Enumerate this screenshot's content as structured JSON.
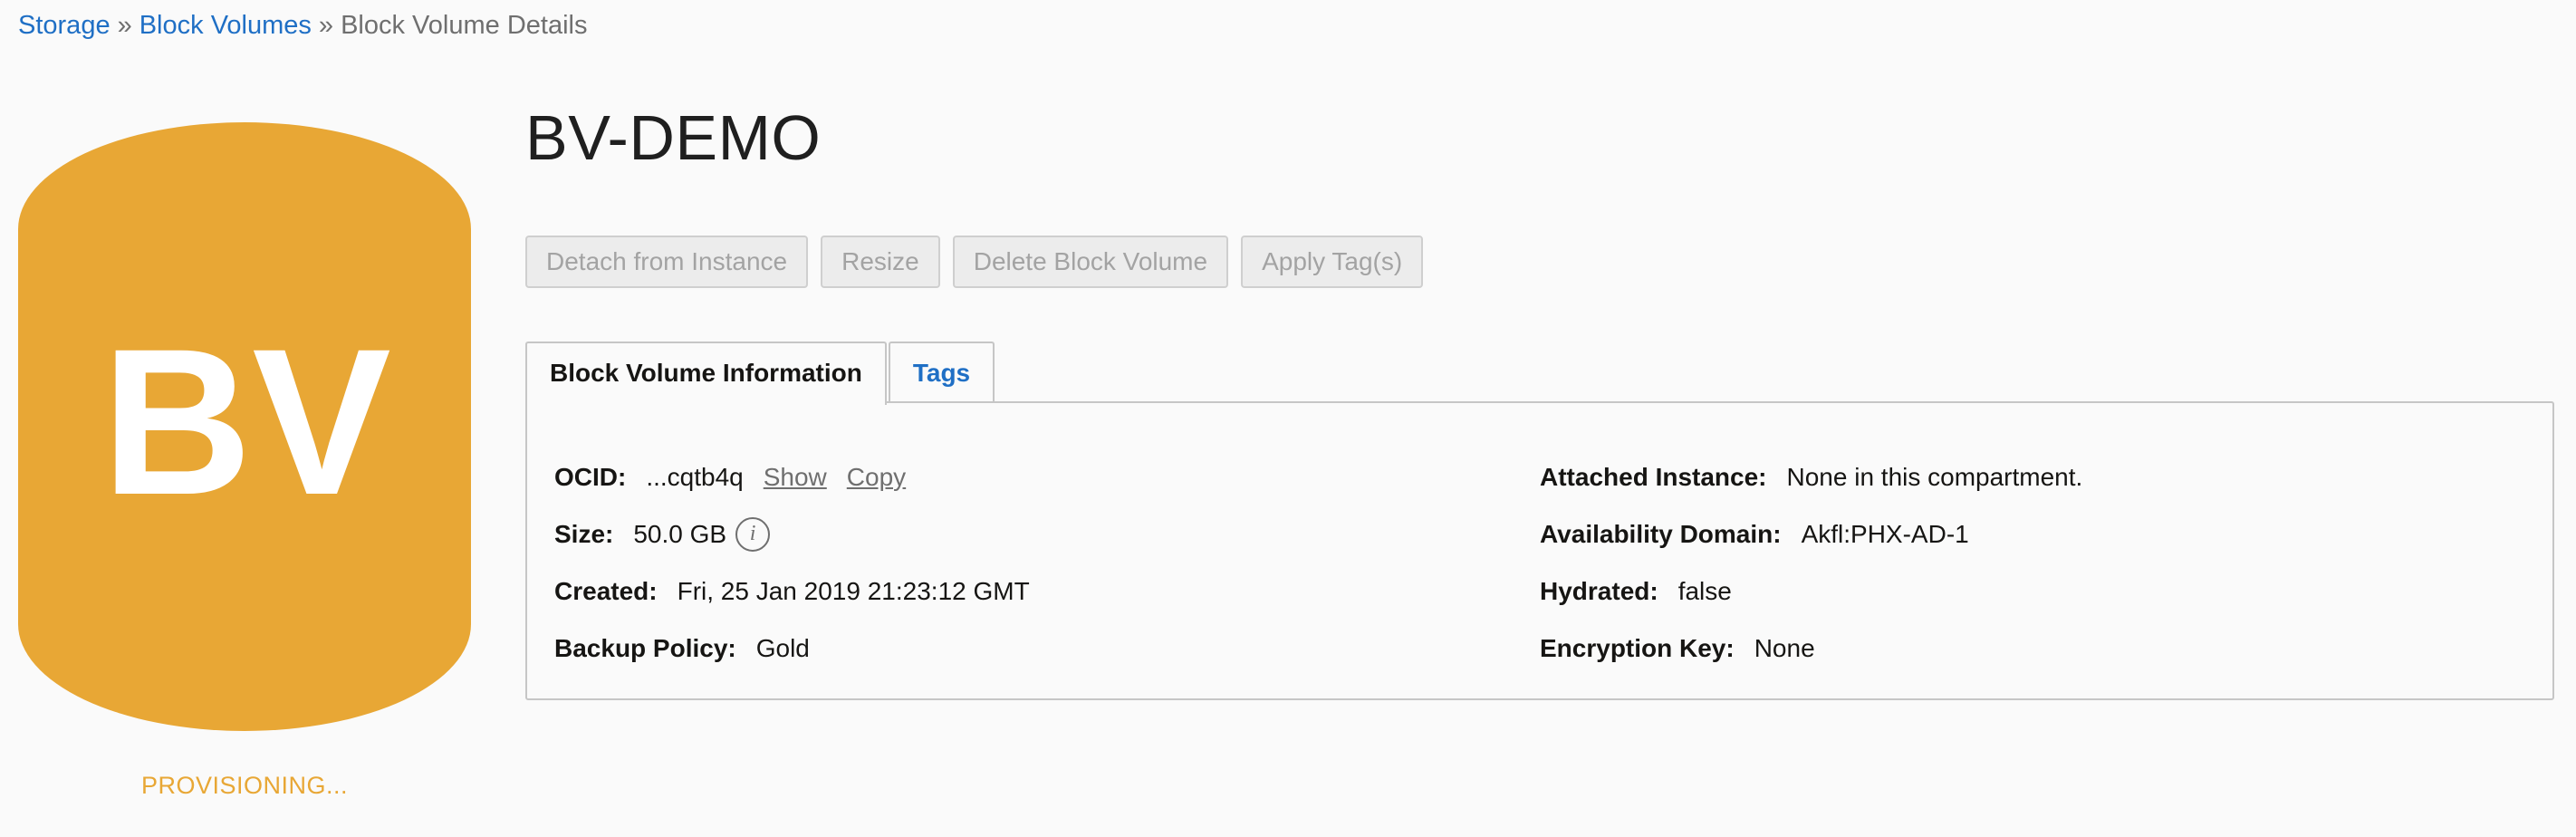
{
  "breadcrumb": {
    "items": [
      "Storage",
      "Block Volumes",
      "Block Volume Details"
    ],
    "separator": "»"
  },
  "resource": {
    "icon_text": "BV",
    "icon_color": "#e8a735",
    "status": "PROVISIONING..."
  },
  "title": "BV-DEMO",
  "actions": {
    "detach": "Detach from Instance",
    "resize": "Resize",
    "delete": "Delete Block Volume",
    "apply_tags": "Apply Tag(s)"
  },
  "tabs": [
    {
      "label": "Block Volume Information",
      "active": true
    },
    {
      "label": "Tags",
      "active": false
    }
  ],
  "info": {
    "ocid": {
      "label": "OCID:",
      "value": "...cqtb4q",
      "show": "Show",
      "copy": "Copy"
    },
    "size": {
      "label": "Size:",
      "value": "50.0 GB"
    },
    "created": {
      "label": "Created:",
      "value": "Fri, 25 Jan 2019 21:23:12 GMT"
    },
    "backup_policy": {
      "label": "Backup Policy:",
      "value": "Gold"
    },
    "attached_instance": {
      "label": "Attached Instance:",
      "value": "None in this compartment."
    },
    "availability_domain": {
      "label": "Availability Domain:",
      "value": "Akfl:PHX-AD-1"
    },
    "hydrated": {
      "label": "Hydrated:",
      "value": "false"
    },
    "encryption_key": {
      "label": "Encryption Key:",
      "value": "None"
    }
  },
  "colors": {
    "link": "#1f6fc5",
    "status": "#e8a735",
    "disabled_text": "#a3a3a3"
  }
}
